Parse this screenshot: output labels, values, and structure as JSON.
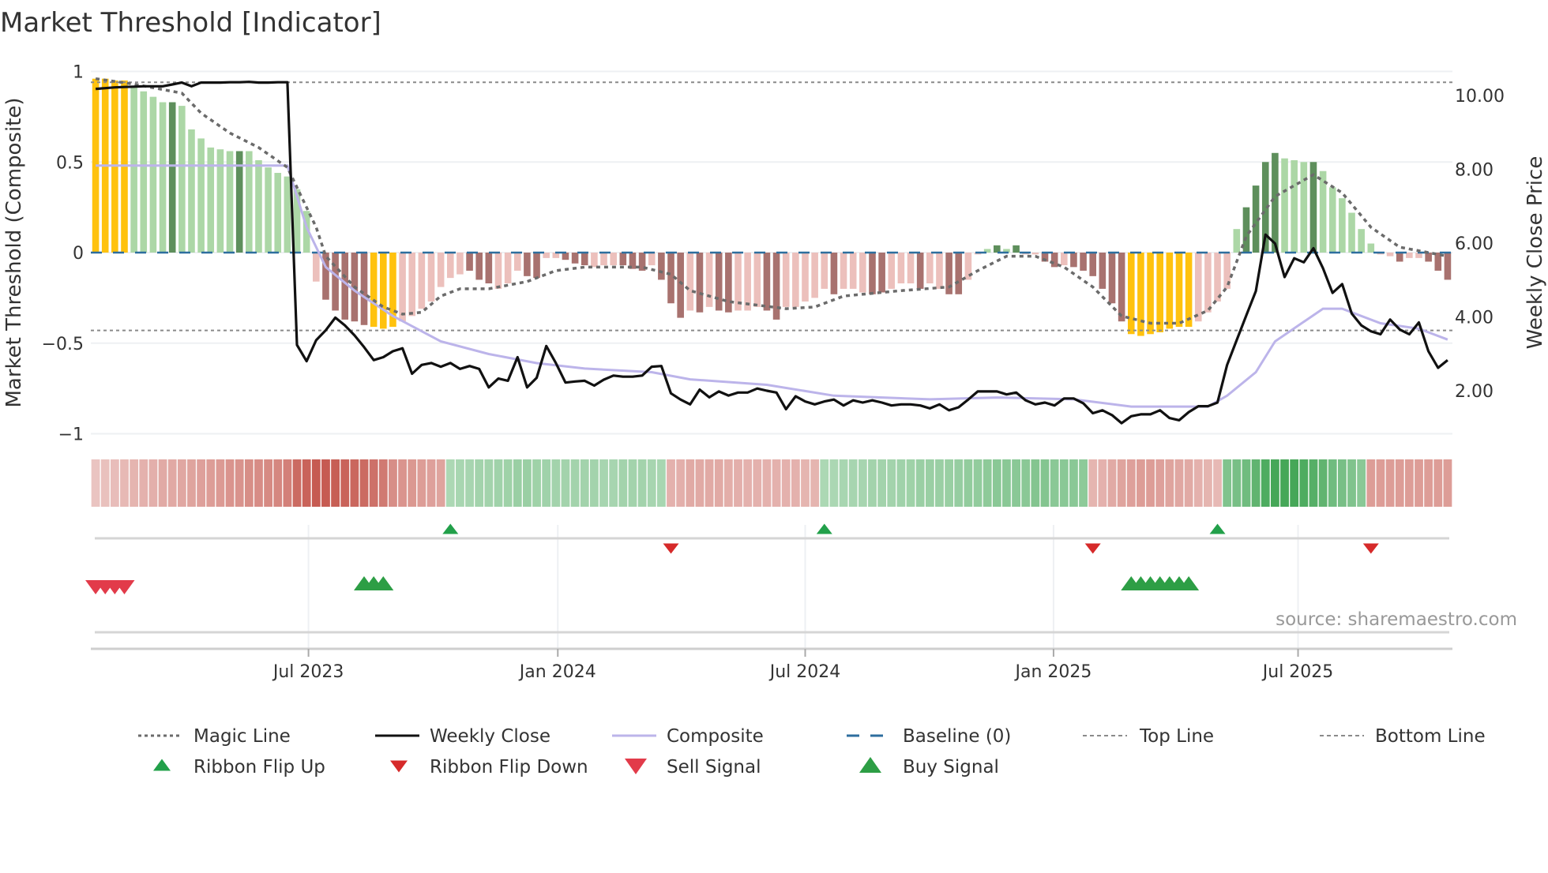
{
  "chart_data": {
    "type": "bar",
    "title": "Market Threshold [Indicator]",
    "ylabel": "Market Threshold (Composite)",
    "y2label": "Weekly Close Price",
    "ylim": [
      -1,
      1
    ],
    "y2lim": [
      0.6,
      10.4
    ],
    "yticks": [
      "1",
      "0.5",
      "0",
      "−0.5",
      "−1"
    ],
    "ytick_values": [
      1,
      0.5,
      0,
      -0.5,
      -1
    ],
    "y2ticks": [
      "10.00",
      "8.00",
      "6.00",
      "4.00",
      "2.00"
    ],
    "y2tick_values": [
      10,
      8,
      6,
      4,
      2
    ],
    "xticks": [
      {
        "label": "Jul 2023",
        "week": 22.2
      },
      {
        "label": "Jan 2024",
        "week": 48.2
      },
      {
        "label": "Jul 2024",
        "week": 74.0
      },
      {
        "label": "Jan 2025",
        "week": 99.9
      },
      {
        "label": "Jul 2025",
        "week": 125.4
      }
    ],
    "n_weeks": 142,
    "top_line": 0.94,
    "bottom_line": -0.43,
    "baseline": 0,
    "composite_bars": [
      0.96,
      0.96,
      0.95,
      0.95,
      0.92,
      0.89,
      0.86,
      0.83,
      0.83,
      0.81,
      0.68,
      0.63,
      0.58,
      0.57,
      0.56,
      0.56,
      0.56,
      0.51,
      0.47,
      0.44,
      0.42,
      0.35,
      0.23,
      -0.16,
      -0.26,
      -0.32,
      -0.37,
      -0.38,
      -0.4,
      -0.41,
      -0.42,
      -0.41,
      -0.38,
      -0.35,
      -0.31,
      -0.27,
      -0.19,
      -0.14,
      -0.12,
      -0.1,
      -0.15,
      -0.17,
      -0.2,
      -0.17,
      -0.1,
      -0.13,
      -0.14,
      -0.03,
      -0.03,
      -0.04,
      -0.06,
      -0.07,
      -0.08,
      -0.07,
      -0.07,
      -0.07,
      -0.09,
      -0.1,
      -0.07,
      -0.15,
      -0.28,
      -0.36,
      -0.32,
      -0.33,
      -0.3,
      -0.32,
      -0.33,
      -0.32,
      -0.32,
      -0.3,
      -0.32,
      -0.37,
      -0.3,
      -0.3,
      -0.27,
      -0.25,
      -0.2,
      -0.23,
      -0.2,
      -0.2,
      -0.22,
      -0.23,
      -0.22,
      -0.2,
      -0.17,
      -0.17,
      -0.2,
      -0.17,
      -0.2,
      -0.23,
      -0.23,
      -0.15,
      -0.01,
      0.02,
      0.04,
      0.02,
      0.04,
      -0.01,
      -0.01,
      -0.05,
      -0.08,
      -0.07,
      -0.08,
      -0.1,
      -0.13,
      -0.2,
      -0.28,
      -0.38,
      -0.45,
      -0.46,
      -0.45,
      -0.44,
      -0.42,
      -0.41,
      -0.41,
      -0.38,
      -0.33,
      -0.27,
      -0.2,
      0.13,
      0.25,
      0.37,
      0.5,
      0.55,
      0.52,
      0.51,
      0.5,
      0.5,
      0.45,
      0.36,
      0.3,
      0.22,
      0.13,
      0.05,
      -0.01,
      -0.02,
      -0.05,
      -0.03,
      -0.03,
      -0.05,
      -0.1,
      -0.15
    ],
    "bar_classes": [
      "Y",
      "Y",
      "Y",
      "Y",
      "G",
      "G",
      "G",
      "G",
      "DG",
      "G",
      "G",
      "G",
      "G",
      "G",
      "G",
      "DG",
      "G",
      "G",
      "G",
      "G",
      "G",
      "G",
      "G",
      "R",
      "DR",
      "DR",
      "DR",
      "DR",
      "DR",
      "Y",
      "Y",
      "Y",
      "R",
      "R",
      "R",
      "R",
      "R",
      "R",
      "R",
      "DR",
      "DR",
      "DR",
      "R",
      "R",
      "R",
      "DR",
      "DR",
      "R",
      "R",
      "DR",
      "DR",
      "DR",
      "R",
      "R",
      "R",
      "DR",
      "DR",
      "DR",
      "R",
      "DR",
      "DR",
      "DR",
      "R",
      "DR",
      "R",
      "DR",
      "DR",
      "R",
      "R",
      "R",
      "DR",
      "DR",
      "R",
      "R",
      "R",
      "R",
      "R",
      "DR",
      "R",
      "R",
      "R",
      "DR",
      "DR",
      "R",
      "R",
      "R",
      "DR",
      "R",
      "R",
      "DR",
      "DR",
      "R",
      "R",
      "G",
      "DG",
      "G",
      "DG",
      "R",
      "R",
      "DR",
      "DR",
      "R",
      "DR",
      "DR",
      "DR",
      "DR",
      "DR",
      "DR",
      "Y",
      "Y",
      "Y",
      "Y",
      "Y",
      "Y",
      "Y",
      "R",
      "R",
      "R",
      "R",
      "G",
      "DG",
      "DG",
      "DG",
      "DG",
      "G",
      "G",
      "G",
      "DG",
      "G",
      "G",
      "G",
      "G",
      "G",
      "G",
      "R",
      "R",
      "DR",
      "R",
      "R",
      "DR",
      "DR",
      "DR"
    ],
    "weekly_close": [
      10.18,
      10.2,
      10.22,
      10.23,
      10.24,
      10.25,
      10.25,
      10.25,
      10.3,
      10.35,
      10.25,
      10.35,
      10.35,
      10.35,
      10.36,
      10.36,
      10.37,
      10.35,
      10.35,
      10.36,
      10.36,
      3.24,
      2.8,
      3.37,
      3.64,
      3.98,
      3.77,
      3.5,
      3.18,
      2.83,
      2.91,
      3.07,
      3.15,
      2.46,
      2.7,
      2.75,
      2.65,
      2.75,
      2.59,
      2.67,
      2.59,
      2.09,
      2.33,
      2.27,
      2.91,
      2.09,
      2.35,
      3.21,
      2.75,
      2.22,
      2.25,
      2.27,
      2.14,
      2.3,
      2.41,
      2.38,
      2.38,
      2.41,
      2.65,
      2.67,
      1.93,
      1.76,
      1.63,
      2.03,
      1.82,
      1.98,
      1.87,
      1.95,
      1.95,
      2.06,
      2.0,
      1.95,
      1.5,
      1.85,
      1.71,
      1.63,
      1.71,
      1.76,
      1.6,
      1.74,
      1.68,
      1.74,
      1.68,
      1.6,
      1.63,
      1.63,
      1.6,
      1.52,
      1.63,
      1.47,
      1.55,
      1.76,
      1.98,
      1.98,
      1.98,
      1.9,
      1.95,
      1.74,
      1.63,
      1.68,
      1.6,
      1.79,
      1.79,
      1.66,
      1.39,
      1.47,
      1.34,
      1.12,
      1.31,
      1.36,
      1.36,
      1.47,
      1.26,
      1.2,
      1.42,
      1.58,
      1.58,
      1.68,
      2.7,
      3.37,
      4.04,
      4.7,
      6.23,
      5.99,
      5.08,
      5.59,
      5.48,
      5.86,
      5.32,
      4.65,
      4.89,
      4.09,
      3.77,
      3.61,
      3.53,
      3.93,
      3.66,
      3.53,
      3.85,
      3.07,
      2.62,
      2.83
    ],
    "magic_line": [
      [
        0,
        0.96
      ],
      [
        4,
        0.93
      ],
      [
        9,
        0.88
      ],
      [
        11,
        0.77
      ],
      [
        14,
        0.66
      ],
      [
        17,
        0.58
      ],
      [
        20,
        0.47
      ],
      [
        21,
        0.36
      ],
      [
        23,
        0.14
      ],
      [
        24,
        -0.02
      ],
      [
        27,
        -0.19
      ],
      [
        30,
        -0.3
      ],
      [
        32,
        -0.34
      ],
      [
        34,
        -0.33
      ],
      [
        36,
        -0.24
      ],
      [
        38,
        -0.2
      ],
      [
        41,
        -0.2
      ],
      [
        45,
        -0.16
      ],
      [
        48,
        -0.1
      ],
      [
        51,
        -0.08
      ],
      [
        57,
        -0.08
      ],
      [
        60,
        -0.12
      ],
      [
        62,
        -0.21
      ],
      [
        66,
        -0.27
      ],
      [
        72,
        -0.31
      ],
      [
        75,
        -0.3
      ],
      [
        78,
        -0.24
      ],
      [
        84,
        -0.21
      ],
      [
        89,
        -0.19
      ],
      [
        92,
        -0.1
      ],
      [
        95,
        -0.02
      ],
      [
        98,
        -0.02
      ],
      [
        101,
        -0.08
      ],
      [
        104,
        -0.19
      ],
      [
        107,
        -0.35
      ],
      [
        110,
        -0.39
      ],
      [
        113,
        -0.39
      ],
      [
        116,
        -0.32
      ],
      [
        118,
        -0.19
      ],
      [
        120,
        0.09
      ],
      [
        123,
        0.31
      ],
      [
        127,
        0.43
      ],
      [
        130,
        0.33
      ],
      [
        133,
        0.14
      ],
      [
        136,
        0.03
      ],
      [
        141,
        -0.02
      ]
    ],
    "composite_line": [
      [
        0,
        0.48
      ],
      [
        20,
        0.48
      ],
      [
        22,
        0.14
      ],
      [
        24,
        -0.08
      ],
      [
        27,
        -0.21
      ],
      [
        31,
        -0.35
      ],
      [
        36,
        -0.49
      ],
      [
        41,
        -0.56
      ],
      [
        46,
        -0.61
      ],
      [
        51,
        -0.64
      ],
      [
        58,
        -0.66
      ],
      [
        62,
        -0.7
      ],
      [
        70,
        -0.73
      ],
      [
        77,
        -0.79
      ],
      [
        87,
        -0.81
      ],
      [
        94,
        -0.8
      ],
      [
        102,
        -0.81
      ],
      [
        108,
        -0.85
      ],
      [
        116,
        -0.85
      ],
      [
        118,
        -0.79
      ],
      [
        121,
        -0.66
      ],
      [
        123,
        -0.49
      ],
      [
        128,
        -0.31
      ],
      [
        130,
        -0.31
      ],
      [
        134,
        -0.39
      ],
      [
        138,
        -0.42
      ],
      [
        141,
        -0.48
      ]
    ],
    "ribbon": [
      -0.18,
      -0.2,
      -0.22,
      -0.25,
      -0.28,
      -0.3,
      -0.32,
      -0.35,
      -0.36,
      -0.38,
      -0.4,
      -0.42,
      -0.45,
      -0.47,
      -0.5,
      -0.52,
      -0.55,
      -0.56,
      -0.58,
      -0.6,
      -0.65,
      -0.8,
      -0.85,
      -0.9,
      -0.9,
      -0.88,
      -0.85,
      -0.82,
      -0.8,
      -0.75,
      -0.7,
      -0.55,
      -0.5,
      -0.48,
      -0.45,
      -0.42,
      -0.4,
      0.25,
      0.27,
      0.28,
      0.3,
      0.3,
      0.32,
      0.33,
      0.35,
      0.35,
      0.33,
      0.32,
      0.3,
      0.3,
      0.3,
      0.3,
      0.3,
      0.28,
      0.28,
      0.3,
      0.3,
      0.3,
      0.28,
      0.27,
      -0.3,
      -0.32,
      -0.35,
      -0.35,
      -0.35,
      -0.35,
      -0.33,
      -0.32,
      -0.3,
      -0.3,
      -0.3,
      -0.3,
      -0.3,
      -0.3,
      -0.28,
      -0.28,
      0.25,
      0.26,
      0.27,
      0.28,
      0.28,
      0.3,
      0.3,
      0.3,
      0.32,
      0.33,
      0.35,
      0.35,
      0.35,
      0.37,
      0.38,
      0.4,
      0.4,
      0.42,
      0.45,
      0.45,
      0.45,
      0.45,
      0.48,
      0.48,
      0.45,
      0.45,
      0.45,
      0.42,
      -0.28,
      -0.3,
      -0.35,
      -0.4,
      -0.42,
      -0.45,
      -0.45,
      -0.42,
      -0.4,
      -0.38,
      -0.35,
      -0.3,
      -0.28,
      -0.25,
      0.5,
      0.55,
      0.6,
      0.7,
      0.8,
      0.85,
      0.85,
      0.85,
      0.8,
      0.75,
      0.7,
      0.6,
      0.55,
      0.5,
      0.45,
      -0.45,
      -0.45,
      -0.45,
      -0.45,
      -0.45,
      -0.45,
      -0.45,
      -0.45,
      -0.45
    ],
    "ribbon_flip_up": [
      37,
      76,
      117
    ],
    "ribbon_flip_down": [
      60,
      104,
      133
    ],
    "sell_signals": [
      0,
      1,
      2,
      3
    ],
    "buy_signals": [
      28,
      29,
      30,
      108,
      109,
      110,
      111,
      112,
      113,
      114
    ],
    "legend": [
      {
        "label": "Magic Line",
        "key": "magic"
      },
      {
        "label": "Weekly Close",
        "key": "close"
      },
      {
        "label": "Composite",
        "key": "composite"
      },
      {
        "label": "Baseline (0)",
        "key": "baseline"
      },
      {
        "label": "Top Line",
        "key": "top"
      },
      {
        "label": "Bottom Line",
        "key": "bottom"
      },
      {
        "label": "Ribbon Flip Up",
        "key": "flipup"
      },
      {
        "label": "Ribbon Flip Down",
        "key": "flipdown"
      },
      {
        "label": "Sell Signal",
        "key": "sell"
      },
      {
        "label": "Buy Signal",
        "key": "buy"
      }
    ],
    "legend_position": "bottom",
    "source": "source: sharemaestro.com"
  },
  "colors": {
    "Y": "#ffc20e",
    "G": "#acd7a6",
    "DG": "#5e8f5c",
    "R": "#ecc0bc",
    "DR": "#a8726f",
    "magic": "#6b6b6b",
    "close": "#111111",
    "composite": "#bcb4ea",
    "baseline": "#2d6e9e",
    "topbottom": "#8a8a8a",
    "flipup": "#22a04a",
    "flipdown": "#d62a2a",
    "sell": "#e23b4a",
    "buy": "#2d9e45",
    "ribbon_red": "196,86,76",
    "ribbon_green": "54,160,74",
    "grid": "#eef0f3"
  }
}
